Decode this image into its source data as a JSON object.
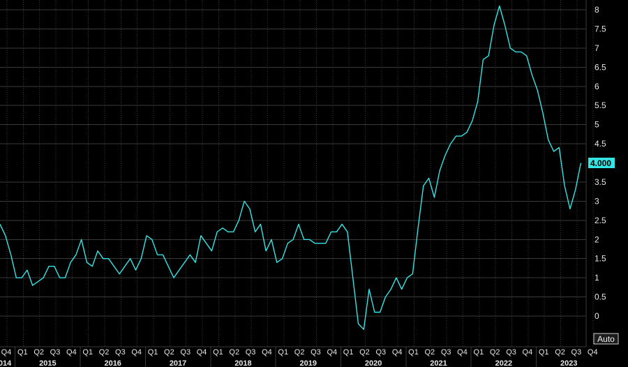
{
  "auto_button_label": "Auto",
  "chart_data": {
    "type": "line",
    "title": "",
    "xlabel": "",
    "ylabel": "",
    "series_color": "#34e5e5",
    "background": "#000000",
    "last_value_label": "4.000",
    "ylim": [
      -0.35,
      8.2
    ],
    "y_ticks": [
      {
        "value": 8,
        "label": "8"
      },
      {
        "value": 7.5,
        "label": "7.5"
      },
      {
        "value": 7,
        "label": "7"
      },
      {
        "value": 6.5,
        "label": "6.5"
      },
      {
        "value": 6,
        "label": "6"
      },
      {
        "value": 5.5,
        "label": "5.5"
      },
      {
        "value": 5,
        "label": "5"
      },
      {
        "value": 4.5,
        "label": "4.5"
      },
      {
        "value": 3.5,
        "label": "3.5"
      },
      {
        "value": 3,
        "label": "3"
      },
      {
        "value": 2.5,
        "label": "2.5"
      },
      {
        "value": 2,
        "label": "2"
      },
      {
        "value": 1.5,
        "label": "1.5"
      },
      {
        "value": 1,
        "label": "1"
      },
      {
        "value": 0.5,
        "label": "0.5"
      },
      {
        "value": 0,
        "label": "0"
      }
    ],
    "x_start": "2014-12",
    "quarter_ticks": [
      "Q4",
      "Q1",
      "Q2",
      "Q3",
      "Q4",
      "Q1",
      "Q2",
      "Q3",
      "Q4",
      "Q1",
      "Q2",
      "Q3",
      "Q4",
      "Q1",
      "Q2",
      "Q3",
      "Q4",
      "Q1",
      "Q2",
      "Q3",
      "Q4",
      "Q1",
      "Q2",
      "Q3",
      "Q4",
      "Q1",
      "Q2",
      "Q3",
      "Q4",
      "Q1",
      "Q2",
      "Q3",
      "Q4",
      "Q1",
      "Q2",
      "Q3",
      "Q4"
    ],
    "year_ticks": [
      "2014",
      "2015",
      "2016",
      "2017",
      "2018",
      "2019",
      "2020",
      "2021",
      "2022",
      "2023"
    ],
    "values": [
      2.4,
      2.1,
      1.6,
      1.0,
      1.0,
      1.2,
      0.8,
      0.9,
      1.0,
      1.3,
      1.3,
      1.0,
      1.0,
      1.4,
      1.6,
      2.0,
      1.4,
      1.3,
      1.7,
      1.5,
      1.5,
      1.3,
      1.1,
      1.3,
      1.5,
      1.2,
      1.5,
      2.1,
      2.0,
      1.6,
      1.6,
      1.3,
      1.0,
      1.2,
      1.4,
      1.6,
      1.4,
      2.1,
      1.9,
      1.7,
      2.2,
      2.3,
      2.2,
      2.2,
      2.5,
      3.0,
      2.8,
      2.2,
      2.4,
      1.7,
      2.0,
      1.4,
      1.5,
      1.9,
      2.0,
      2.4,
      2.0,
      2.0,
      1.9,
      1.9,
      1.9,
      2.2,
      2.2,
      2.4,
      2.2,
      1.0,
      -0.2,
      -0.35,
      0.7,
      0.1,
      0.1,
      0.5,
      0.7,
      1.0,
      0.7,
      1.0,
      1.1,
      2.3,
      3.4,
      3.6,
      3.1,
      3.8,
      4.2,
      4.5,
      4.7,
      4.7,
      4.8,
      5.1,
      5.6,
      6.7,
      6.8,
      7.6,
      8.1,
      7.6,
      7.0,
      6.9,
      6.9,
      6.8,
      6.3,
      5.9,
      5.3,
      4.6,
      4.3,
      4.4,
      3.4,
      2.8,
      3.3,
      4.0
    ]
  }
}
